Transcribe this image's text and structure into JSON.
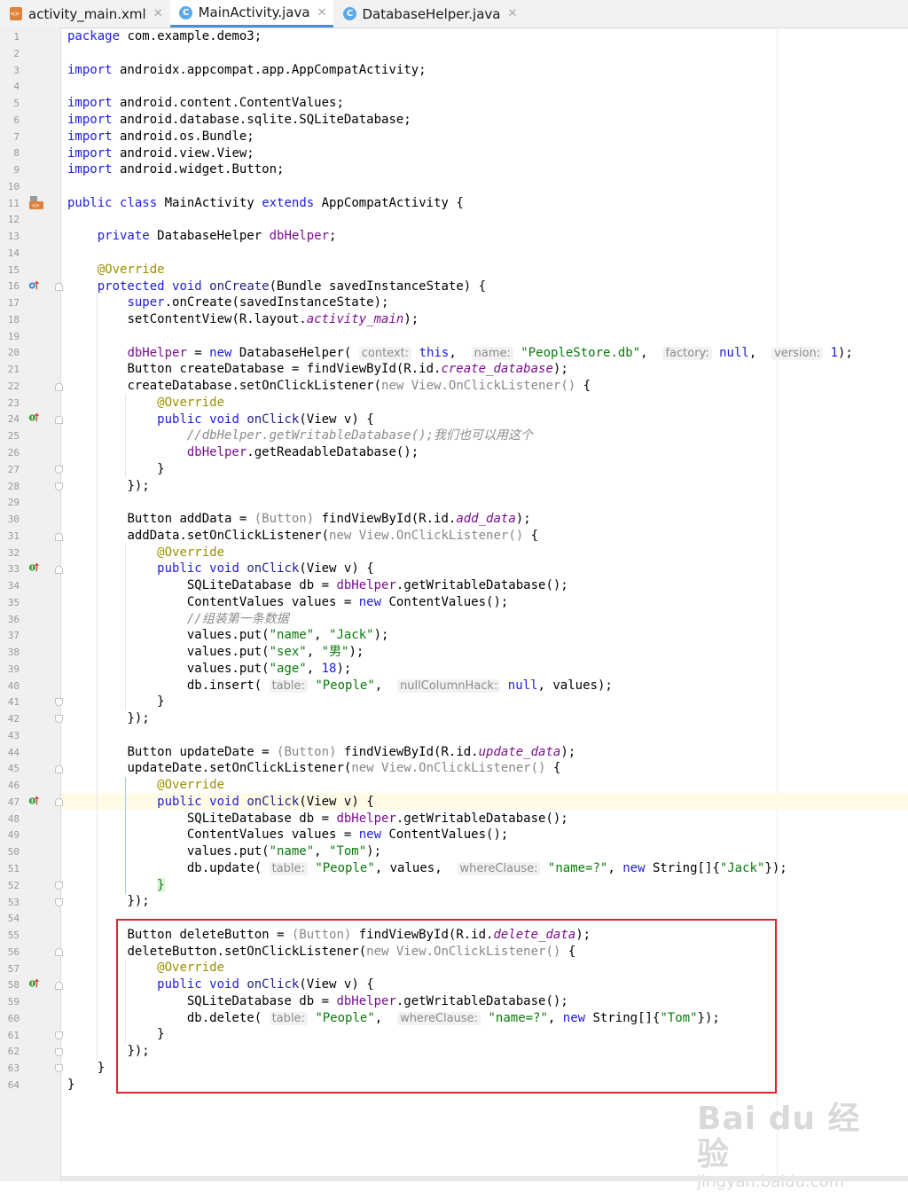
{
  "tabs": [
    {
      "label": "activity_main.xml",
      "icon": "xml-file-icon"
    },
    {
      "label": "MainActivity.java",
      "icon": "java-class-icon"
    },
    {
      "label": "DatabaseHelper.java",
      "icon": "java-class-icon"
    }
  ],
  "active_tab": "MainActivity.java",
  "code": {
    "l1_pkg": "package",
    "l1_rest": " com.example.demo3;",
    "imp": "import",
    "l3_rest": " androidx.appcompat.app.AppCompatActivity;",
    "l5_rest": " android.content.ContentValues;",
    "l6_rest": " android.database.sqlite.SQLiteDatabase;",
    "l7_rest": " android.os.Bundle;",
    "l8_rest": " android.view.View;",
    "l9_rest": " android.widget.Button;",
    "public": "public",
    "class": "class",
    "extends": "extends",
    "private": "private",
    "protected": "protected",
    "void": "void",
    "super": "super",
    "new": "new",
    "this": "this",
    "null": "null",
    "l11_name": " MainActivity ",
    "l11_parent": " AppCompatActivity {",
    "l13_type": " DatabaseHelper ",
    "l13_field": "dbHelper",
    "l13_end": ";",
    "override": "@Override",
    "l16_m": "onCreate",
    "l16_rest": "(Bundle savedInstanceState) {",
    "l17_rest": ".onCreate(savedInstanceState);",
    "l18_a": "setContentView(R.layout.",
    "l18_f": "activity_main",
    "l18_b": ");",
    "dbHelper": "dbHelper",
    "l20_a": " = ",
    "l20_b": " DatabaseHelper( ",
    "hint_context": "context:",
    "hint_name": "name:",
    "hint_factory": "factory:",
    "hint_version": "version:",
    "l20_str": "\"PeopleStore.db\"",
    "l20_num": "1",
    "l20_end": ");",
    "l21_a": "Button createDatabase = findViewById(R.id.",
    "l21_f": "create_database",
    "l21_b": ");",
    "l22_a": "createDatabase.setOnClickListener(",
    "listener": " View.OnClickListener()",
    "l22_b": " {",
    "onClick": "onClick",
    "view_param": "(View v) {",
    "l25_comment": "//dbHelper.getWritableDatabase();我们也可以用这个",
    "l26_b": ".getReadableDatabase();",
    "close_brace": "}",
    "close_paren": "});",
    "l30_a": "Button addData = ",
    "cast_button": "(Button)",
    "l30_b": " findViewById(R.id.",
    "l30_f": "add_data",
    "l30_c": ");",
    "l31_a": "addData.setOnClickListener(",
    "l34_a": "SQLiteDatabase db = ",
    "l34_b": ".getWritableDatabase();",
    "l35_a": "ContentValues values = ",
    "l35_b": " ContentValues();",
    "l36_comment": "//组装第一条数据",
    "put": "values.put(",
    "s_name": "\"name\"",
    "s_jack": "\"Jack\"",
    "s_sex": "\"sex\"",
    "s_male": "\"男\"",
    "s_age": "\"age\"",
    "n_18": "18",
    "s_tom": "\"Tom\"",
    "comma": ", ",
    "put_end": ");",
    "l40_a": "db.insert( ",
    "hint_table": "table:",
    "s_people": "\"People\"",
    "hint_nullcol": "nullColumnHack:",
    "l40_b": ", values);",
    "l44_a": "Button updateDate = ",
    "l44_f": "update_data",
    "l45_a": "updateDate.setOnClickListener(",
    "l51_a": "db.update( ",
    "l51_b": ", values, ",
    "hint_where": "whereClause:",
    "s_where": "\"name=?\"",
    "l51_c": " String[]{",
    "l51_d": "});",
    "l55_a": "Button deleteButton = ",
    "l55_f": "delete_data",
    "l56_a": "deleteButton.setOnClickListener(",
    "l60_a": "db.delete( "
  },
  "watermark": {
    "main": "Bai du 经验",
    "sub": "jingyan.baidu.com"
  }
}
